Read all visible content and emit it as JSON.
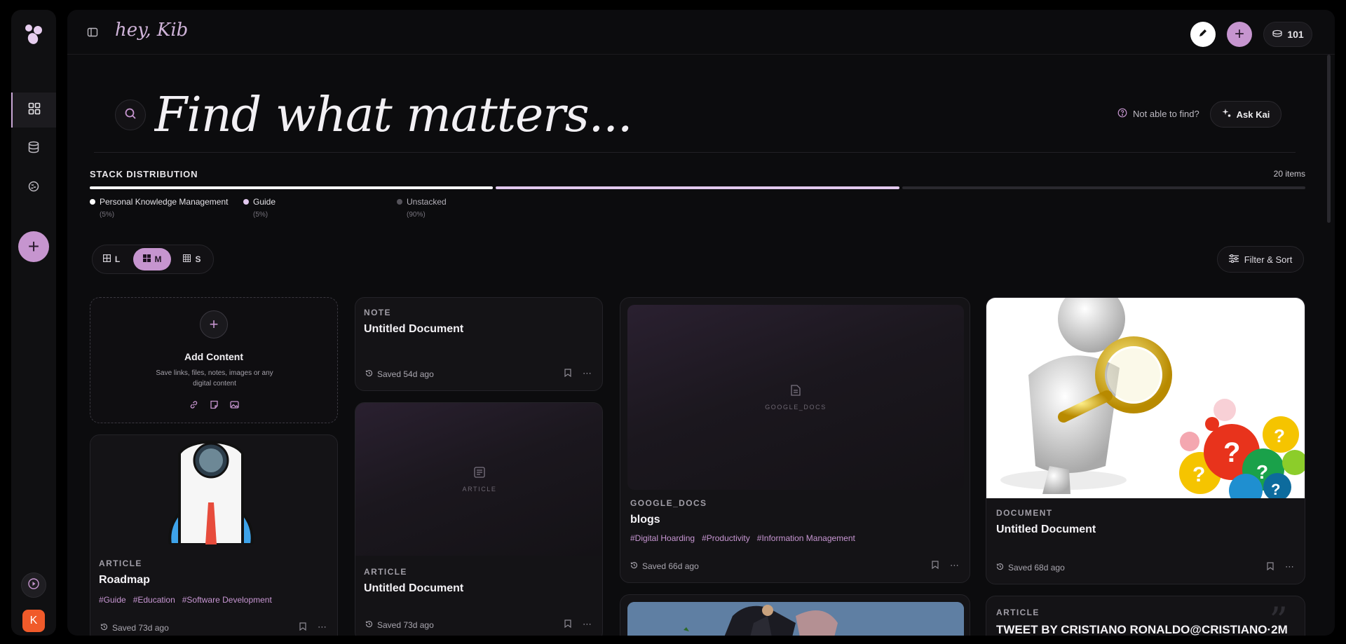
{
  "header": {
    "greeting": "hey, Kib",
    "credits": "101"
  },
  "search": {
    "placeholder": "Find what matters...",
    "not_able_to_find": "Not able to find?",
    "ask_kai": "Ask Kai"
  },
  "stack": {
    "title": "STACK DISTRIBUTION",
    "count": "20 items",
    "segments": [
      {
        "label": "Personal Knowledge Management",
        "pct": "(5%)",
        "fraction": 0.05,
        "color": "#ffffff"
      },
      {
        "label": "Guide",
        "pct": "(5%)",
        "fraction": 0.05,
        "color": "#e2c8ee"
      },
      {
        "label": "Unstacked",
        "pct": "(90%)",
        "fraction": 0.9,
        "color": "#2a292e"
      }
    ]
  },
  "view": {
    "sizes": [
      "L",
      "M",
      "S"
    ],
    "selected": "M",
    "filter_sort": "Filter & Sort"
  },
  "add_content": {
    "title": "Add Content",
    "subtitle": "Save links, files, notes, images or any digital content"
  },
  "cards": {
    "roadmap": {
      "type": "ARTICLE",
      "title": "Roadmap",
      "tags": [
        "#Guide",
        "#Education",
        "#Software Development"
      ],
      "saved": "Saved 73d ago"
    },
    "note": {
      "type": "NOTE",
      "title": "Untitled Document",
      "saved": "Saved 54d ago"
    },
    "article_untitled": {
      "type": "ARTICLE",
      "title": "Untitled Document",
      "saved": "Saved 73d ago",
      "placeholder_label": "ARTICLE"
    },
    "blogs": {
      "type": "GOOGLE_DOCS",
      "title": "blogs",
      "tags": [
        "#Digital Hoarding",
        "#Productivity",
        "#Information Management"
      ],
      "saved": "Saved 66d ago",
      "placeholder_label": "GOOGLE_DOCS"
    },
    "document": {
      "type": "DOCUMENT",
      "title": "Untitled Document",
      "saved": "Saved 68d ago"
    },
    "tweet": {
      "type": "ARTICLE",
      "title": "TWEET BY CRISTIANO RONALDO@CRISTIANO·2M"
    }
  },
  "colors": {
    "accent": "#c695cf",
    "avatar": "#f05a2a",
    "tag": "#c796d2"
  },
  "rail": {
    "avatar_initial": "K",
    "icons": [
      "dashboard-icon",
      "database-icon",
      "brain-icon"
    ]
  }
}
